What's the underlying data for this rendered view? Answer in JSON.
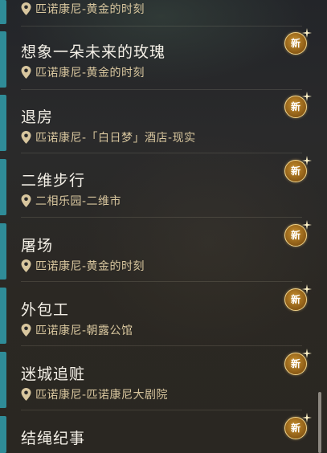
{
  "items": [
    {
      "title": "",
      "location": "匹诺康尼-黄金的时刻",
      "badge": "新"
    },
    {
      "title": "想象一朵未来的玫瑰",
      "location": "匹诺康尼-黄金的时刻",
      "badge": "新"
    },
    {
      "title": "退房",
      "location": "匹诺康尼-「白日梦」酒店-现实",
      "badge": "新"
    },
    {
      "title": "二维步行",
      "location": "二相乐园-二维市",
      "badge": "新"
    },
    {
      "title": "屠场",
      "location": "匹诺康尼-黄金的时刻",
      "badge": "新"
    },
    {
      "title": "外包工",
      "location": "匹诺康尼-朝露公馆",
      "badge": "新"
    },
    {
      "title": "迷城追赃",
      "location": "匹诺康尼-匹诺康尼大剧院",
      "badge": "新"
    },
    {
      "title": "结绳纪事",
      "location": "",
      "badge": "新"
    }
  ],
  "colors": {
    "accent_bar": "#2f8c98",
    "location_text": "#d8c69e",
    "title_text": "#f3efe6",
    "badge_gold": "#c8902e"
  },
  "icons": {
    "location": "map-pin-icon",
    "new_badge": "new-badge-icon"
  }
}
